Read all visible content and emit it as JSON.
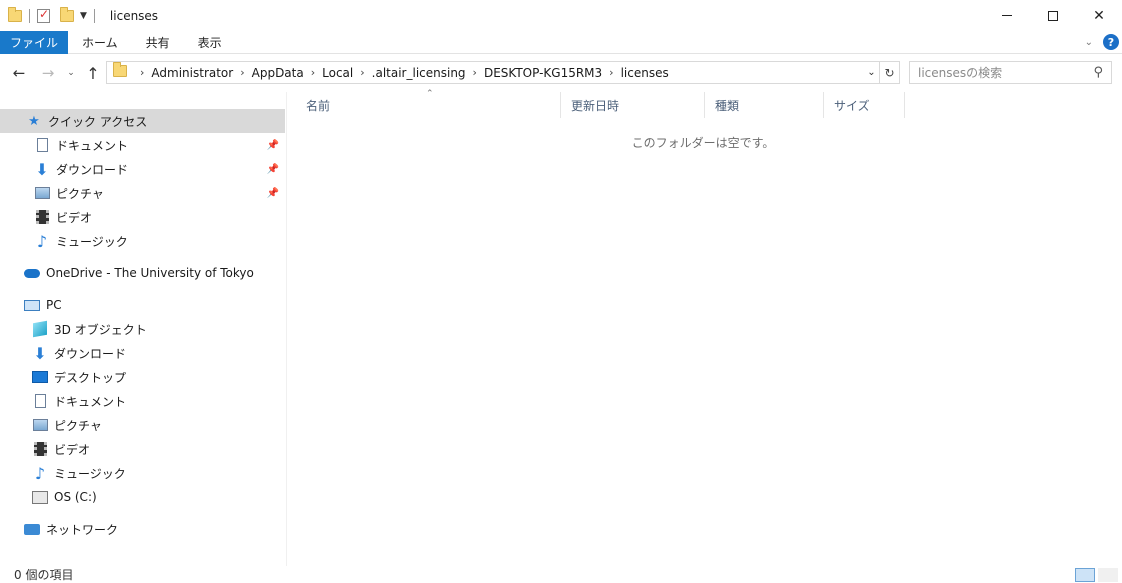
{
  "window": {
    "title": "licenses",
    "minimize_glyph": "",
    "close_glyph": "✕"
  },
  "ribbon": {
    "tabs": [
      "ファイル",
      "ホーム",
      "共有",
      "表示"
    ],
    "help_glyph": "?"
  },
  "address": {
    "crumbs": [
      "Administrator",
      "AppData",
      "Local",
      ".altair_licensing",
      "DESKTOP-KG15RM3",
      "licenses"
    ],
    "separator": "›"
  },
  "search": {
    "placeholder": "licensesの検索"
  },
  "nav": {
    "quick_access": "クイック アクセス",
    "quick_items": [
      "ドキュメント",
      "ダウンロード",
      "ピクチャ",
      "ビデオ",
      "ミュージック"
    ],
    "onedrive": "OneDrive - The University of Tokyo",
    "pc": "PC",
    "pc_items": [
      "3D オブジェクト",
      "ダウンロード",
      "デスクトップ",
      "ドキュメント",
      "ピクチャ",
      "ビデオ",
      "ミュージック",
      "OS (C:)"
    ],
    "network": "ネットワーク"
  },
  "columns": [
    "名前",
    "更新日時",
    "種類",
    "サイズ"
  ],
  "content": {
    "empty_message": "このフォルダーは空です。"
  },
  "status": {
    "item_count": "0 個の項目"
  },
  "colors": {
    "file_tab": "#1979ca",
    "selected_nav": "#d9d9d9",
    "column_header_text": "#4c607a"
  }
}
